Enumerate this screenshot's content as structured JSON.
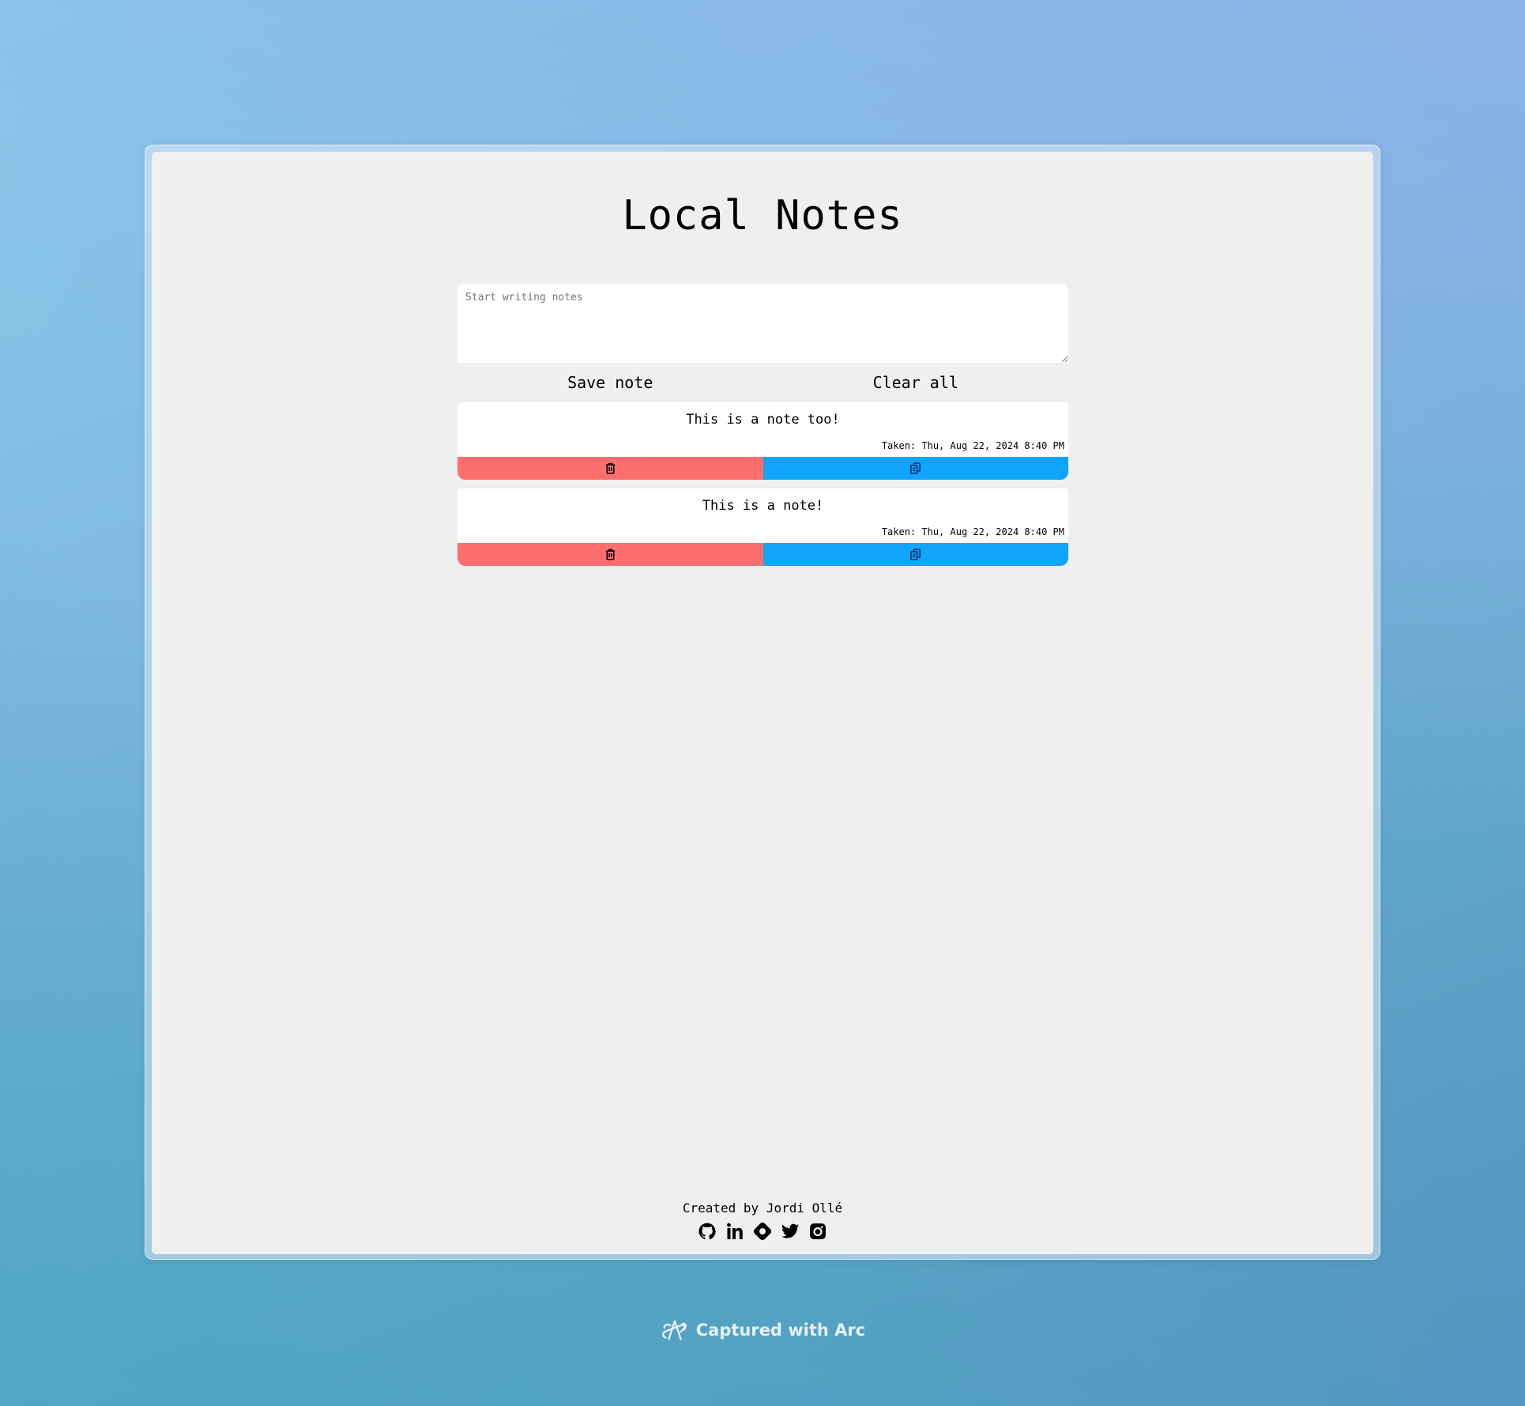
{
  "app": {
    "title": "Local Notes"
  },
  "editor": {
    "placeholder": "Start writing notes",
    "value": ""
  },
  "actions": {
    "save_label": "Save note",
    "clear_label": "Clear all"
  },
  "notes": [
    {
      "text": "This is a note too!",
      "taken": "Taken: Thu, Aug 22, 2024 8:40 PM",
      "delete_icon": "trash-icon",
      "copy_icon": "copy-icon"
    },
    {
      "text": "This is a note!",
      "taken": "Taken: Thu, Aug 22, 2024 8:40 PM",
      "delete_icon": "trash-icon",
      "copy_icon": "copy-icon"
    }
  ],
  "footer": {
    "credit": "Created by Jordi Ollé",
    "socials": [
      "github-icon",
      "linkedin-icon",
      "portfolio-icon",
      "twitter-icon",
      "instagram-icon"
    ]
  },
  "watermark": {
    "label": "Captured with Arc"
  },
  "colors": {
    "delete": "#fe6e6e",
    "copy": "#0ea5fa",
    "panel": "#efefef"
  }
}
